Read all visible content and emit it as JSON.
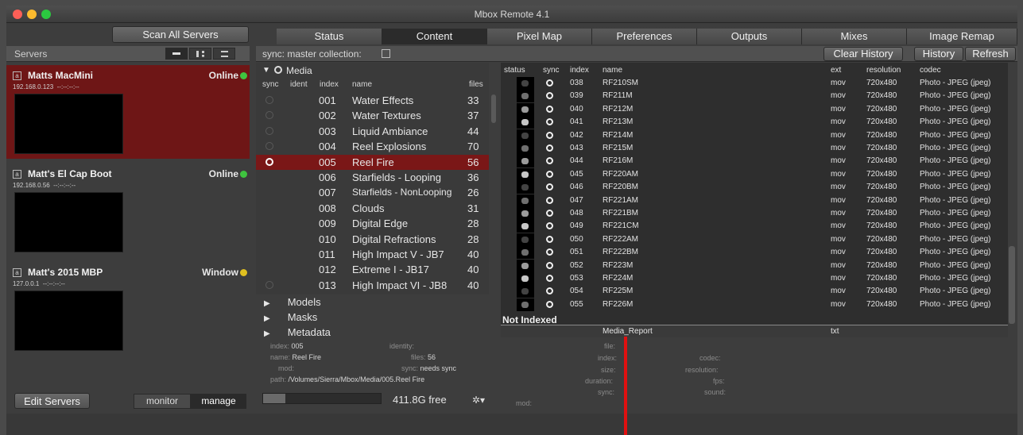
{
  "window": {
    "title": "Mbox Remote 4.1"
  },
  "left": {
    "scan_label": "Scan All Servers",
    "servers_label": "Servers",
    "servers": [
      {
        "name": "Matts MacMini",
        "ip": "192.168.0.123",
        "time": "--:--:--:--",
        "status": "Online",
        "status_color": "#3fc43f",
        "icon": "a"
      },
      {
        "name": "Matt's El Cap Boot",
        "ip": "192.168.0.56",
        "time": "--:--:--:--",
        "status": "Online",
        "status_color": "#3fc43f",
        "icon": "a"
      },
      {
        "name": "Matt's 2015 MBP",
        "ip": "127.0.0.1",
        "time": "--:--:--:--",
        "status": "Window",
        "status_color": "#e0c020",
        "icon": "a"
      }
    ],
    "edit_label": "Edit Servers",
    "monitor_label": "monitor",
    "manage_label": "manage"
  },
  "tabs": [
    "Status",
    "Content",
    "Pixel Map",
    "Preferences",
    "Outputs",
    "Mixes",
    "Image Remap"
  ],
  "sync_label": "sync: master collection:",
  "toolbar": {
    "clear_history": "Clear History",
    "history": "History",
    "refresh": "Refresh"
  },
  "media": {
    "title": "Media",
    "headers": {
      "sync": "sync",
      "ident": "ident",
      "index": "index",
      "name": "name",
      "files": "files"
    },
    "rows": [
      {
        "index": "001",
        "name": "Water Effects",
        "files": "33"
      },
      {
        "index": "002",
        "name": "Water Textures",
        "files": "37"
      },
      {
        "index": "003",
        "name": "Liquid Ambiance",
        "files": "44"
      },
      {
        "index": "004",
        "name": "Reel Explosions",
        "files": "70"
      },
      {
        "index": "005",
        "name": "Reel Fire",
        "files": "56"
      },
      {
        "index": "006",
        "name": "Starfields - Looping",
        "files": "36"
      },
      {
        "index": "007",
        "name": "Starfields - NonLooping",
        "files": "26"
      },
      {
        "index": "008",
        "name": "Clouds",
        "files": "31"
      },
      {
        "index": "009",
        "name": "Digital Edge",
        "files": "28"
      },
      {
        "index": "010",
        "name": "Digital Refractions",
        "files": "28"
      },
      {
        "index": "011",
        "name": "High Impact V - JB7",
        "files": "40"
      },
      {
        "index": "012",
        "name": "Extreme I - JB17",
        "files": "40"
      },
      {
        "index": "013",
        "name": "High Impact VI - JB8",
        "files": "40"
      }
    ],
    "selected_index": 4,
    "tree": [
      "Models",
      "Masks",
      "Metadata"
    ]
  },
  "info": {
    "index_label": "index:",
    "index_value": "005",
    "name_label": "name:",
    "name_value": "Reel Fire",
    "mod_label": "mod:",
    "identity_label": "identity:",
    "files_label": "files:",
    "files_value": "56",
    "sync_label": "sync:",
    "sync_value": "needs sync",
    "path_label": "path:",
    "path_value": "/Volumes/Sierra/Mbox/Media/005.Reel Fire",
    "free": "411.8G free"
  },
  "files": {
    "headers": {
      "status": "status",
      "sync": "sync",
      "index": "index",
      "name": "name",
      "ext": "ext",
      "resolution": "resolution",
      "codec": "codec"
    },
    "rows": [
      {
        "index": "038",
        "name": "RF210SM"
      },
      {
        "index": "039",
        "name": "RF211M"
      },
      {
        "index": "040",
        "name": "RF212M"
      },
      {
        "index": "041",
        "name": "RF213M"
      },
      {
        "index": "042",
        "name": "RF214M"
      },
      {
        "index": "043",
        "name": "RF215M"
      },
      {
        "index": "044",
        "name": "RF216M"
      },
      {
        "index": "045",
        "name": "RF220AM"
      },
      {
        "index": "046",
        "name": "RF220BM"
      },
      {
        "index": "047",
        "name": "RF221AM"
      },
      {
        "index": "048",
        "name": "RF221BM"
      },
      {
        "index": "049",
        "name": "RF221CM"
      },
      {
        "index": "050",
        "name": "RF222AM"
      },
      {
        "index": "051",
        "name": "RF222BM"
      },
      {
        "index": "052",
        "name": "RF223M"
      },
      {
        "index": "053",
        "name": "RF224M"
      },
      {
        "index": "054",
        "name": "RF225M"
      },
      {
        "index": "055",
        "name": "RF226M"
      }
    ],
    "ext": "mov",
    "resolution": "720x480",
    "codec": "Photo - JPEG (jpeg)",
    "not_indexed": "Not Indexed",
    "report_name": "Media_Report",
    "report_ext": "txt"
  },
  "details": {
    "file": "file:",
    "index": "index:",
    "size": "size:",
    "duration": "duration:",
    "sync": "sync:",
    "mod": "mod:",
    "codec": "codec:",
    "resolution": "resolution:",
    "fps": "fps:",
    "sound": "sound:"
  }
}
